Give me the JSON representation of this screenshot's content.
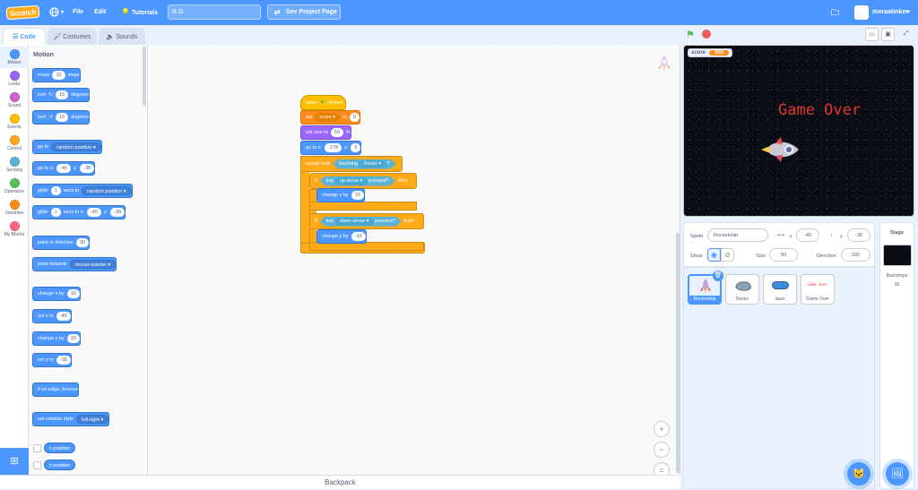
{
  "menubar": {
    "logo": "Scratch",
    "file": "File",
    "edit": "Edit",
    "tutorials": "Tutorials",
    "project_title": "R.G",
    "see_project": "See Project Page",
    "username": "moraatinker"
  },
  "tabs": {
    "code": "Code",
    "costumes": "Costumes",
    "sounds": "Sounds"
  },
  "categories": [
    {
      "label": "Motion",
      "color": "#4c97ff"
    },
    {
      "label": "Looks",
      "color": "#9966ff"
    },
    {
      "label": "Sound",
      "color": "#cf63cf"
    },
    {
      "label": "Events",
      "color": "#ffbf00"
    },
    {
      "label": "Control",
      "color": "#ffab19"
    },
    {
      "label": "Sensing",
      "color": "#5cb1d6"
    },
    {
      "label": "Operators",
      "color": "#59c059"
    },
    {
      "label": "Variables",
      "color": "#ff8c1a"
    },
    {
      "label": "My Blocks",
      "color": "#ff6680"
    }
  ],
  "palette": {
    "title": "Motion",
    "move": {
      "pre": "move",
      "val": "10",
      "post": "steps"
    },
    "turn_right": {
      "pre": "turn",
      "val": "15",
      "post": "degrees"
    },
    "turn_left": {
      "pre": "turn",
      "val": "15",
      "post": "degrees"
    },
    "goto": {
      "pre": "go to",
      "dd": "random position"
    },
    "goto_xy": {
      "pre": "go to x:",
      "x": "-40",
      "y_lbl": "y:",
      "y": "-38"
    },
    "glide_to": {
      "pre": "glide",
      "val": "1",
      "mid": "secs to",
      "dd": "random position"
    },
    "glide_xy": {
      "pre": "glide",
      "val": "1",
      "mid": "secs to x:",
      "x": "-40",
      "y_lbl": "y:",
      "y": "-38"
    },
    "point_dir": {
      "pre": "point in direction",
      "val": "90"
    },
    "point_towards": {
      "pre": "point towards",
      "dd": "mouse-pointer"
    },
    "change_x": {
      "pre": "change x by",
      "val": "10"
    },
    "set_x": {
      "pre": "set x to",
      "val": "-40"
    },
    "change_y": {
      "pre": "change y by",
      "val": "10"
    },
    "set_y": {
      "pre": "set y to",
      "val": "-38"
    },
    "bounce": "if on edge, bounce",
    "rotation": {
      "pre": "set rotation style",
      "dd": "left-right"
    },
    "x_position": "x position",
    "y_position": "y position"
  },
  "script": {
    "when_flag": {
      "pre": "when",
      "post": "clicked"
    },
    "set_var": {
      "pre": "set",
      "dd": "score",
      "mid": "to",
      "val": "0"
    },
    "set_size": {
      "pre": "set size to",
      "val": "50",
      "post": "%"
    },
    "goto_xy": {
      "pre": "go to x:",
      "x": "-178",
      "y_lbl": "y:",
      "y": "5"
    },
    "repeat_until": {
      "pre": "repeat until",
      "cond_pre": "touching",
      "cond_dd": "Rocks",
      "cond_post": "?"
    },
    "if1": {
      "pre": "if",
      "key_pre": "key",
      "key_dd": "up arrow",
      "key_post": "pressed?",
      "then": "then"
    },
    "change_y1": {
      "pre": "change y by",
      "val": "10"
    },
    "if2": {
      "pre": "if",
      "key_pre": "key",
      "key_dd": "down arrow",
      "key_post": "pressed?",
      "then": "then"
    },
    "change_y2": {
      "pre": "change y by",
      "val": "-10"
    }
  },
  "zoom": {
    "in": "+",
    "out": "−",
    "reset": "="
  },
  "backpack": "Backpack",
  "stage": {
    "score_label": "score",
    "score_value": "200",
    "game_over": "Game Over"
  },
  "sprite_info": {
    "sprite_lbl": "Sprite",
    "sprite_name": "Rocketship",
    "x_lbl": "x",
    "x_val": "-40",
    "y_lbl": "y",
    "y_val": "-38",
    "show_lbl": "Show",
    "size_lbl": "Size",
    "size_val": "50",
    "dir_lbl": "Direction",
    "dir_val": "180"
  },
  "sprites": [
    {
      "name": "Rocketship"
    },
    {
      "name": "Rocks"
    },
    {
      "name": "laser"
    },
    {
      "name": "Game Over"
    }
  ],
  "stage_pane": {
    "title": "Stage",
    "backdrops_lbl": "Backdrops",
    "backdrops_count": "20"
  },
  "colors": {
    "accent": "#4c97ff",
    "motion": "#4c97ff",
    "events": "#ffbf00",
    "control": "#ffab19",
    "sensing": "#5cb1d6",
    "variables": "#ff8c1a",
    "looks": "#9966ff"
  }
}
